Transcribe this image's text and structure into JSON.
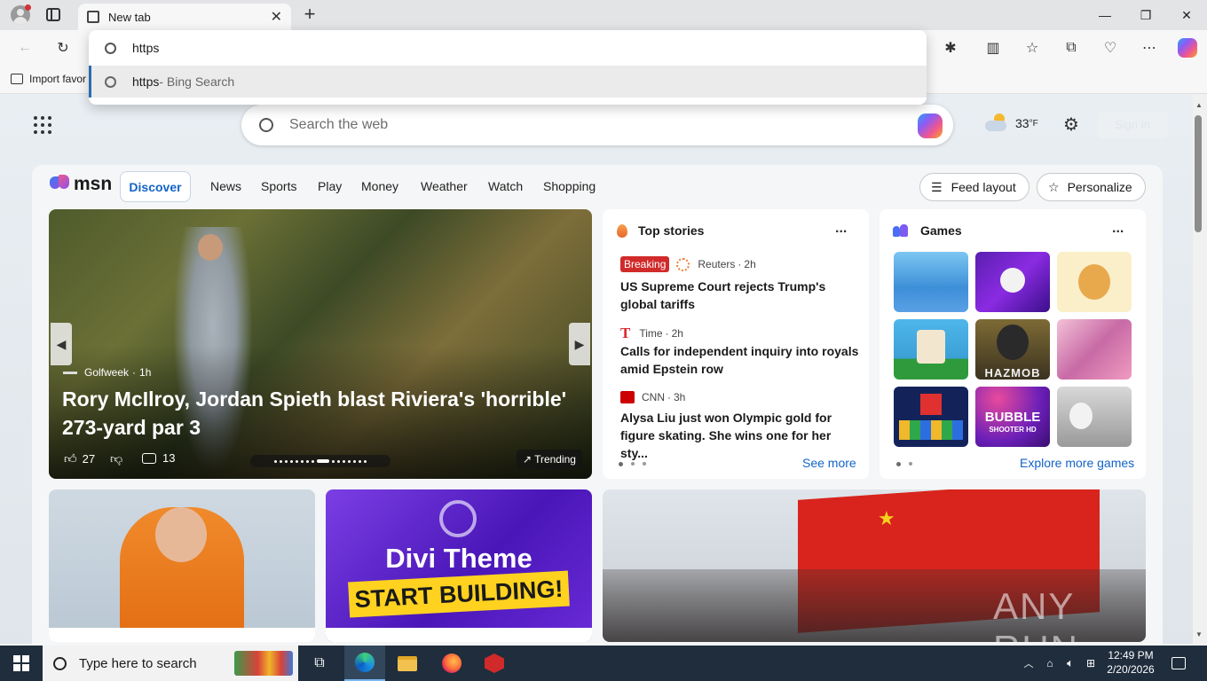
{
  "browser": {
    "tab_title": "New tab",
    "new_tab_glyph": "+",
    "favorites_bar": {
      "import_label": "Import favor"
    },
    "omnibox": {
      "query": "https",
      "suggestion_query": "https",
      "suggestion_suffix": " - Bing Search"
    }
  },
  "ntp": {
    "search_placeholder": "Search the web",
    "weather_temp": "33",
    "weather_unit": "°F",
    "sign_in": "Sign in"
  },
  "msn": {
    "logo_text": "msn",
    "nav": [
      "Discover",
      "News",
      "Sports",
      "Play",
      "Money",
      "Weather",
      "Watch",
      "Shopping"
    ],
    "feed_layout_label": "Feed layout",
    "personalize_label": "Personalize",
    "hero": {
      "source": "Golfweek",
      "age": "1h",
      "headline": "Rory McIlroy, Jordan Spieth blast Riviera's 'horrible' 273-yard par 3",
      "likes": "27",
      "comments": "13",
      "trending": "Trending"
    },
    "top_stories": {
      "title": "Top stories",
      "more": "...",
      "see_more": "See more",
      "items": [
        {
          "badge": "Breaking",
          "source": "Reuters",
          "age": "2h",
          "headline": "US Supreme Court rejects Trump's global tariffs"
        },
        {
          "source": "Time",
          "age": "2h",
          "headline": "Calls for independent inquiry into royals amid Epstein row"
        },
        {
          "source": "CNN",
          "age": "3h",
          "headline": "Alysa Liu just won Olympic gold for figure skating. She wins one for her sty..."
        }
      ]
    },
    "games": {
      "title": "Games",
      "more": "...",
      "explore": "Explore more games",
      "tile_labels": [
        "HAZMOB",
        "BUBBLE",
        "SHOOTER HD"
      ]
    },
    "promo": {
      "line1": "Divi Theme",
      "line2": "START BUILDING!"
    },
    "watermark": "ANY RUN"
  },
  "taskbar": {
    "search_placeholder": "Type here to search",
    "time": "12:49 PM",
    "date": "2/20/2026"
  }
}
